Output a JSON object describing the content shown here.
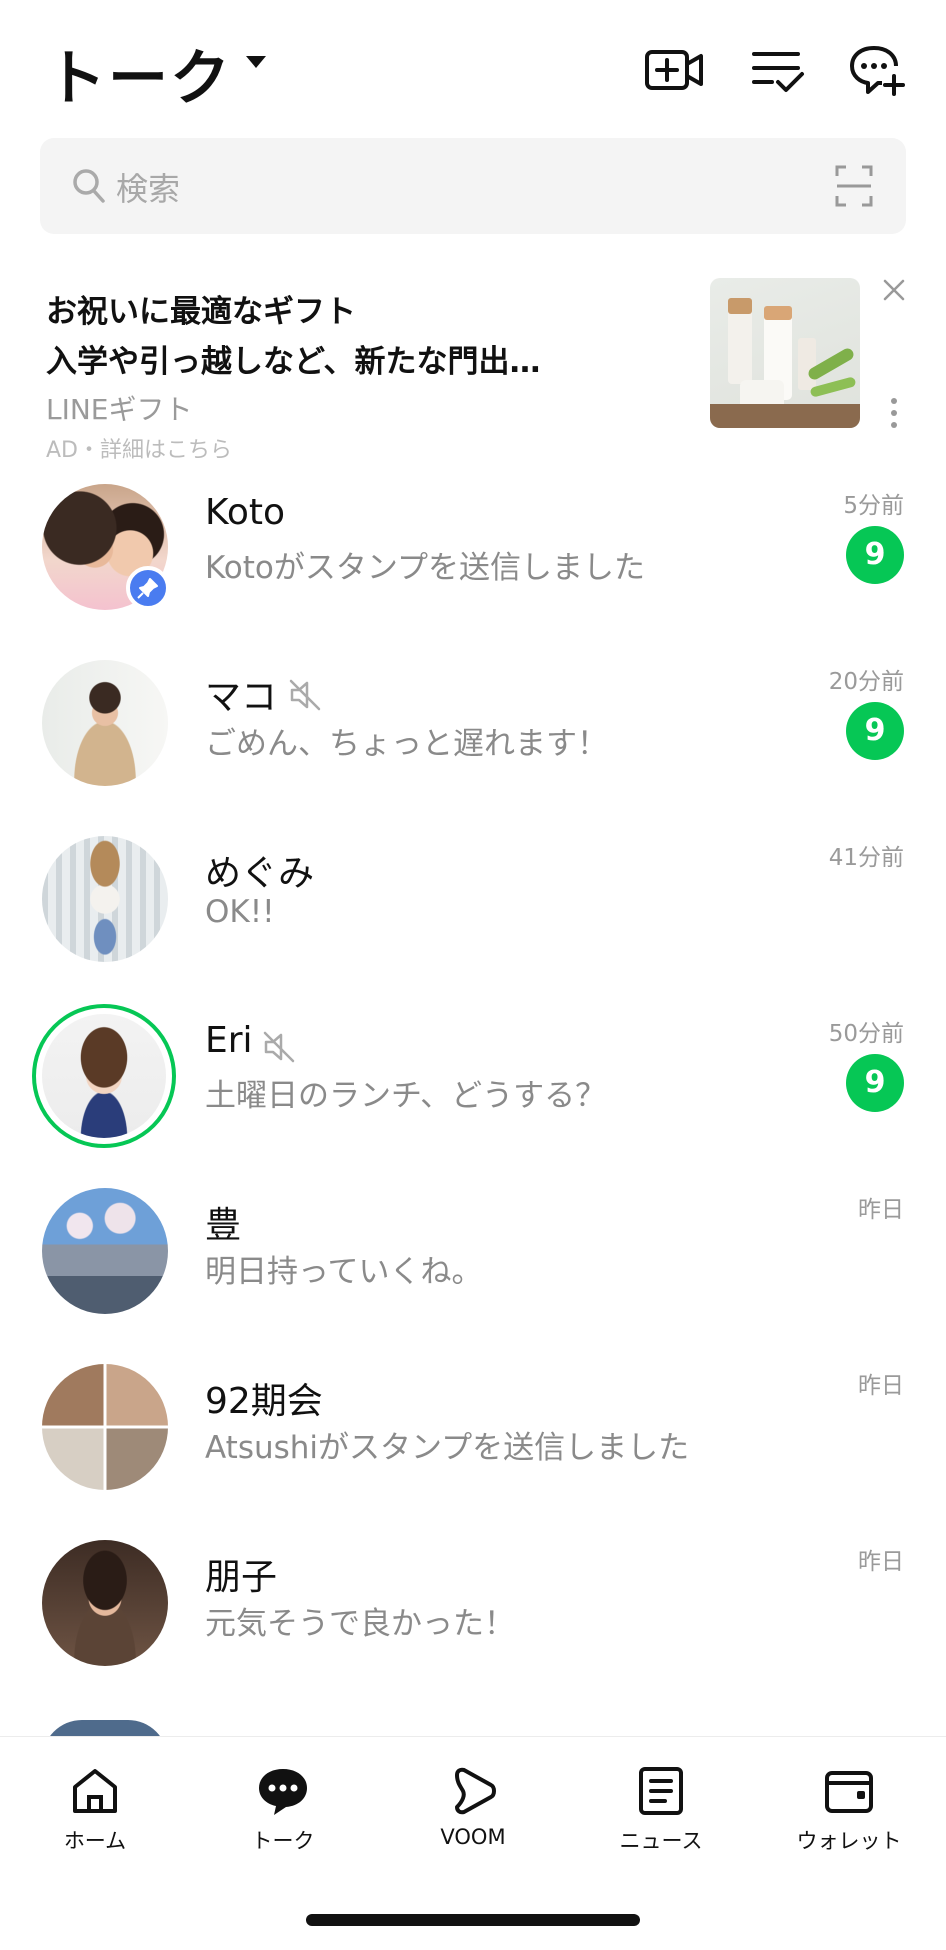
{
  "header": {
    "title": "トーク"
  },
  "search": {
    "placeholder": "検索"
  },
  "ad": {
    "line1": "お祝いに最適なギフト",
    "line2": "入学や引っ越しなど、新たな門出…",
    "brand": "LINEギフト",
    "note": "AD・詳細はこちら"
  },
  "chats": [
    {
      "name": "Koto",
      "message": "Kotoがスタンプを送信しました",
      "time": "5分前",
      "badge": "9",
      "pinned": true,
      "muted": false
    },
    {
      "name": "マコ",
      "message": "ごめん、ちょっと遅れます！",
      "time": "20分前",
      "badge": "9",
      "pinned": false,
      "muted": true
    },
    {
      "name": "めぐみ",
      "message": "OK!!",
      "time": "41分前",
      "badge": "",
      "pinned": false,
      "muted": false
    },
    {
      "name": "Eri",
      "message": "土曜日のランチ、どうする？",
      "time": "50分前",
      "badge": "9",
      "pinned": false,
      "muted": true
    },
    {
      "name": "豊",
      "message": "明日持っていくね。",
      "time": "昨日",
      "badge": "",
      "pinned": false,
      "muted": false
    },
    {
      "name": "92期会",
      "message": "Atsushiがスタンプを送信しました",
      "time": "昨日",
      "badge": "",
      "pinned": false,
      "muted": false
    },
    {
      "name": "朋子",
      "message": "元気そうで良かった！",
      "time": "昨日",
      "badge": "",
      "pinned": false,
      "muted": false
    }
  ],
  "tabs": [
    {
      "label": "ホーム",
      "icon": "home-icon"
    },
    {
      "label": "トーク",
      "icon": "talk-icon"
    },
    {
      "label": "VOOM",
      "icon": "voom-icon"
    },
    {
      "label": "ニュース",
      "icon": "news-icon"
    },
    {
      "label": "ウォレット",
      "icon": "wallet-icon"
    }
  ],
  "colors": {
    "accent": "#06c755",
    "pin": "#4a7cf0"
  }
}
